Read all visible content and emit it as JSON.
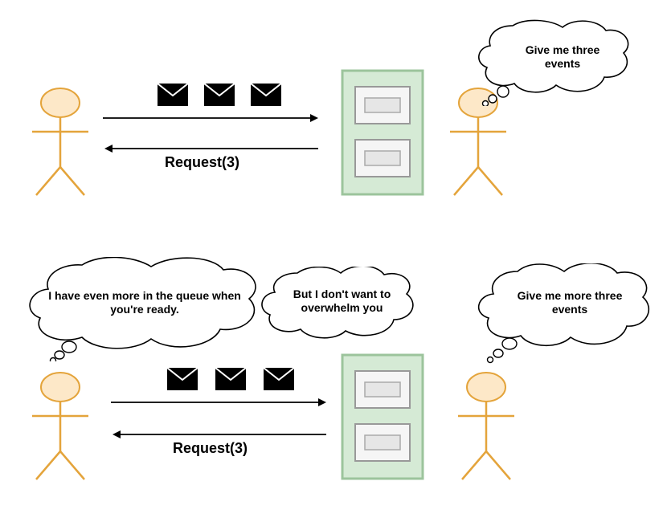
{
  "top": {
    "right_thought": "Give me three events",
    "request_label": "Request(3)"
  },
  "bottom": {
    "left_thought_big": "I have even more in the queue when you're ready.",
    "left_thought_small": "But I don't want to overwhelm you",
    "right_thought": "Give me more three events",
    "request_label": "Request(3)"
  }
}
